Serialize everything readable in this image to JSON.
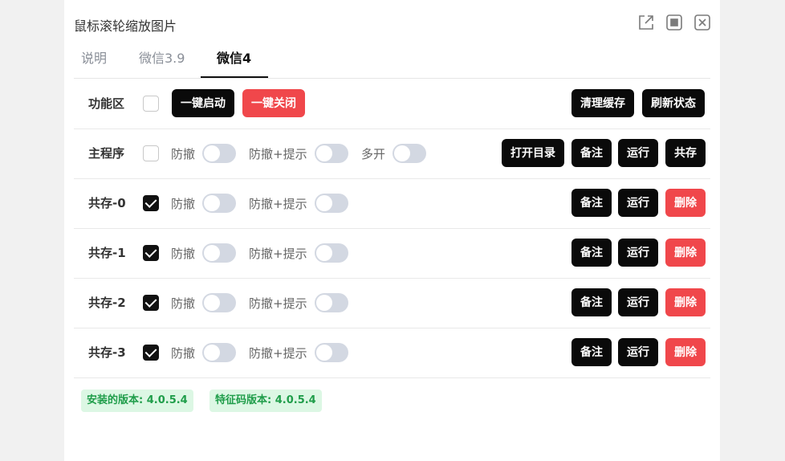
{
  "window": {
    "title": "鼠标滚轮缩放图片",
    "icons": [
      "external-link-icon",
      "stop-icon",
      "close-icon"
    ]
  },
  "tabs": [
    {
      "label": "说明",
      "active": false
    },
    {
      "label": "微信3.9",
      "active": false
    },
    {
      "label": "微信4",
      "active": true
    }
  ],
  "function_row": {
    "label": "功能区",
    "checked": false,
    "start_all": "一键启动",
    "close_all": "一键关闭",
    "clear_cache": "清理缓存",
    "refresh_status": "刷新状态"
  },
  "main_row": {
    "label": "主程序",
    "checked": false,
    "anti_recall": "防撤",
    "anti_recall_hint": "防撤+提示",
    "multi_open": "多开",
    "open_dir": "打开目录",
    "note": "备注",
    "run": "运行",
    "coexist": "共存"
  },
  "coexist_rows": [
    {
      "label": "共存-0",
      "checked": true,
      "anti_recall": "防撤",
      "anti_recall_hint": "防撤+提示",
      "note": "备注",
      "run": "运行",
      "delete": "删除"
    },
    {
      "label": "共存-1",
      "checked": true,
      "anti_recall": "防撤",
      "anti_recall_hint": "防撤+提示",
      "note": "备注",
      "run": "运行",
      "delete": "删除"
    },
    {
      "label": "共存-2",
      "checked": true,
      "anti_recall": "防撤",
      "anti_recall_hint": "防撤+提示",
      "note": "备注",
      "run": "运行",
      "delete": "删除"
    },
    {
      "label": "共存-3",
      "checked": true,
      "anti_recall": "防撤",
      "anti_recall_hint": "防撤+提示",
      "note": "备注",
      "run": "运行",
      "delete": "删除"
    }
  ],
  "badges": {
    "installed_version": "安装的版本: 4.0.5.4",
    "signature_version": "特征码版本: 4.0.5.4"
  },
  "colors": {
    "primary_button": "#0a0a0a",
    "danger_button": "#f0474b",
    "badge_text": "#1f9d4a",
    "badge_bg": "#dcf7e4",
    "toggle_off": "#d3d8e2"
  }
}
